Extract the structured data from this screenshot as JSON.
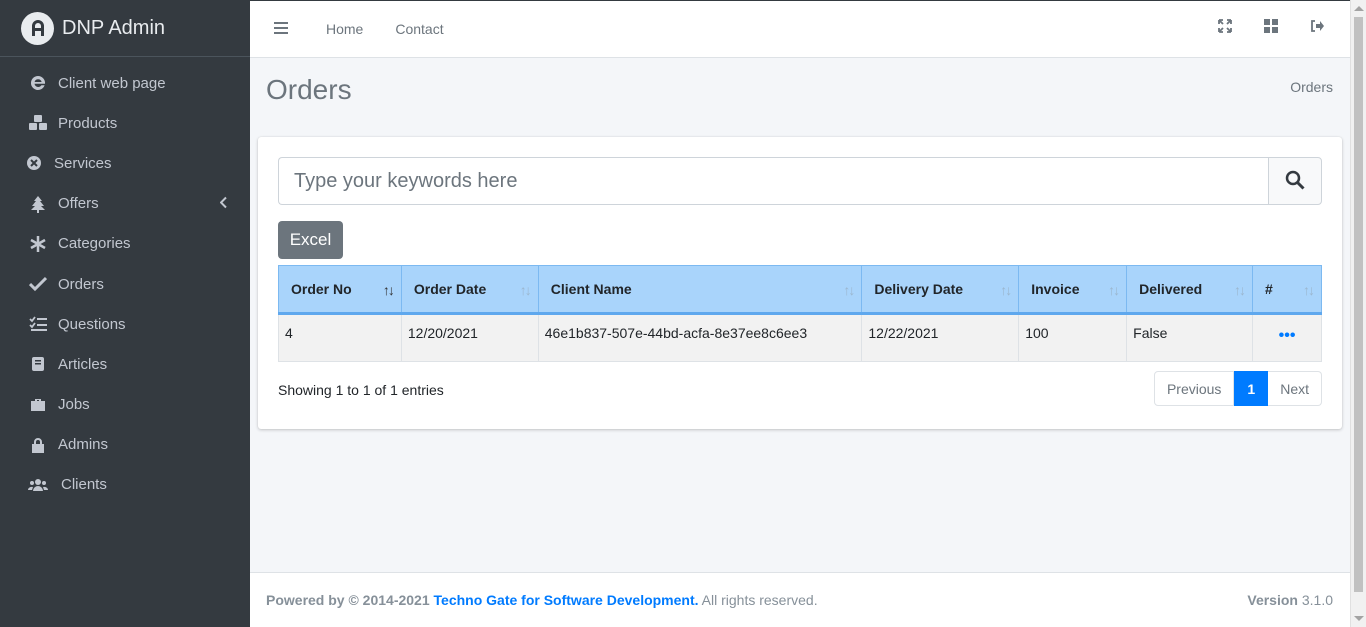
{
  "brand": {
    "name": "DNP Admin"
  },
  "sidebar": {
    "items": [
      {
        "label": "Client web page",
        "icon": "browser-icon"
      },
      {
        "label": "Products",
        "icon": "cubes-icon"
      },
      {
        "label": "Services",
        "icon": "services-icon"
      },
      {
        "label": "Offers",
        "icon": "tree-icon"
      },
      {
        "label": "Categories",
        "icon": "snowflake-icon"
      },
      {
        "label": "Orders",
        "icon": "check-icon"
      },
      {
        "label": "Questions",
        "icon": "tasks-icon"
      },
      {
        "label": "Articles",
        "icon": "book-icon"
      },
      {
        "label": "Jobs",
        "icon": "briefcase-icon"
      },
      {
        "label": "Admins",
        "icon": "lock-icon"
      },
      {
        "label": "Clients",
        "icon": "users-icon"
      }
    ]
  },
  "topbar": {
    "home": "Home",
    "contact": "Contact"
  },
  "page": {
    "title": "Orders",
    "breadcrumb": "Orders"
  },
  "search": {
    "placeholder": "Type your keywords here"
  },
  "excel": {
    "label": "Excel"
  },
  "table": {
    "headers": [
      "Order No",
      "Order Date",
      "Client Name",
      "Delivery Date",
      "Invoice",
      "Delivered",
      "#"
    ],
    "rows": [
      {
        "order_no": "4",
        "order_date": "12/20/2021",
        "client_name": "46e1b837-507e-44bd-acfa-8e37ee8c6ee3",
        "delivery_date": "12/22/2021",
        "invoice": "100",
        "delivered": "False",
        "action": "•••"
      }
    ]
  },
  "pagination": {
    "info": "Showing 1 to 1 of 1 entries",
    "previous": "Previous",
    "current": "1",
    "next": "Next"
  },
  "footer": {
    "powered": "Powered by © 2014-2021",
    "company": "Techno Gate for Software Development.",
    "rights": "All rights reserved.",
    "version_label": "Version",
    "version": "3.1.0"
  },
  "colors": {
    "sidebar": "#343a40",
    "accent": "#007bff",
    "table_header": "#a9d4fb",
    "excel": "#6c757d"
  }
}
